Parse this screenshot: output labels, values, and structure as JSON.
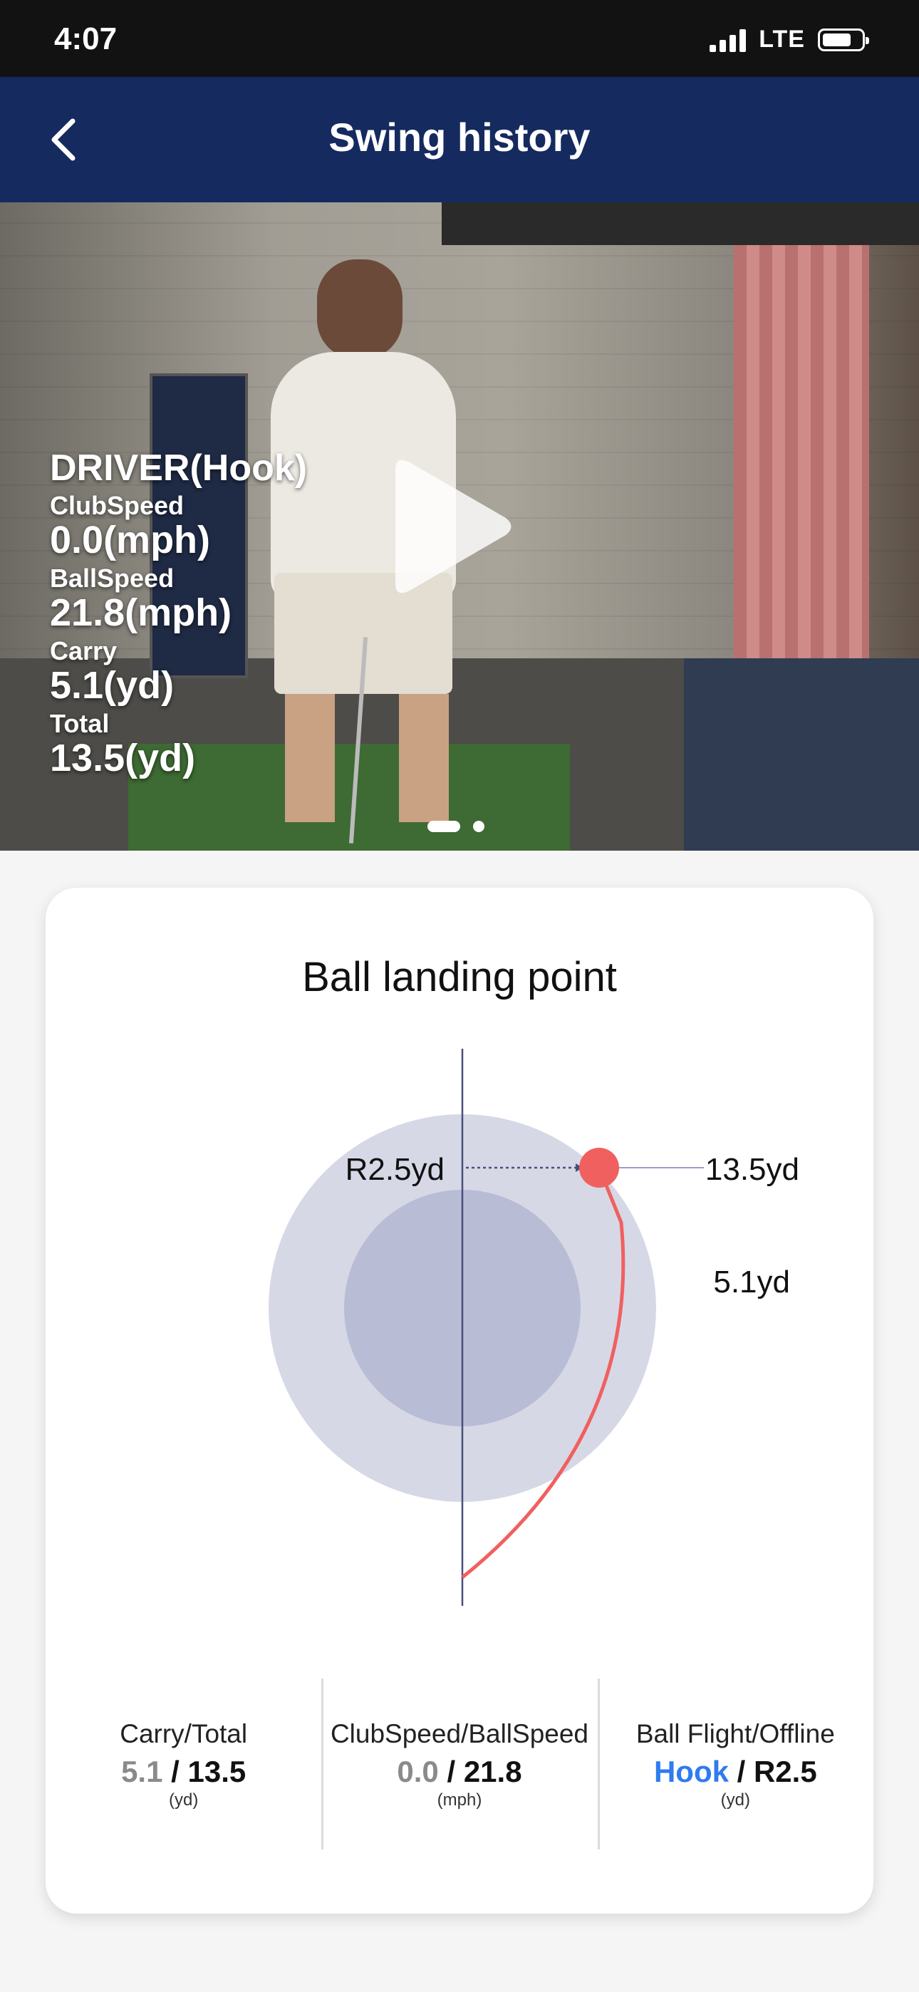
{
  "status_bar": {
    "time": "4:07",
    "network": "LTE",
    "battery_level": 0.75
  },
  "header": {
    "title": "Swing history"
  },
  "video": {
    "club_result": "DRIVER(Hook)",
    "stats": [
      {
        "label": "ClubSpeed",
        "value": "0.0(mph)"
      },
      {
        "label": "BallSpeed",
        "value": "21.8(mph)"
      },
      {
        "label": "Carry",
        "value": "5.1(yd)"
      },
      {
        "label": "Total",
        "value": "13.5(yd)"
      }
    ],
    "pages": 2,
    "active_page": 1
  },
  "landing": {
    "title": "Ball landing point",
    "offline_label": "R2.5yd",
    "total_label": "13.5yd",
    "carry_label": "5.1yd",
    "colors": {
      "outer_ring": "#d6d8e6",
      "inner_ring": "#b8bcd5",
      "trajectory": "#f0605f",
      "axis": "#4a4f7a"
    }
  },
  "summary": [
    {
      "label": "Carry/Total",
      "first": "5.1",
      "sep": " / ",
      "second": "13.5",
      "unit": "(yd)"
    },
    {
      "label": "ClubSpeed/BallSpeed",
      "first": "0.0",
      "sep": " / ",
      "second": "21.8",
      "unit": "(mph)"
    },
    {
      "label": "Ball Flight/Offline",
      "first": "Hook",
      "sep": " / ",
      "second": "R2.5",
      "unit": "(yd)"
    }
  ]
}
